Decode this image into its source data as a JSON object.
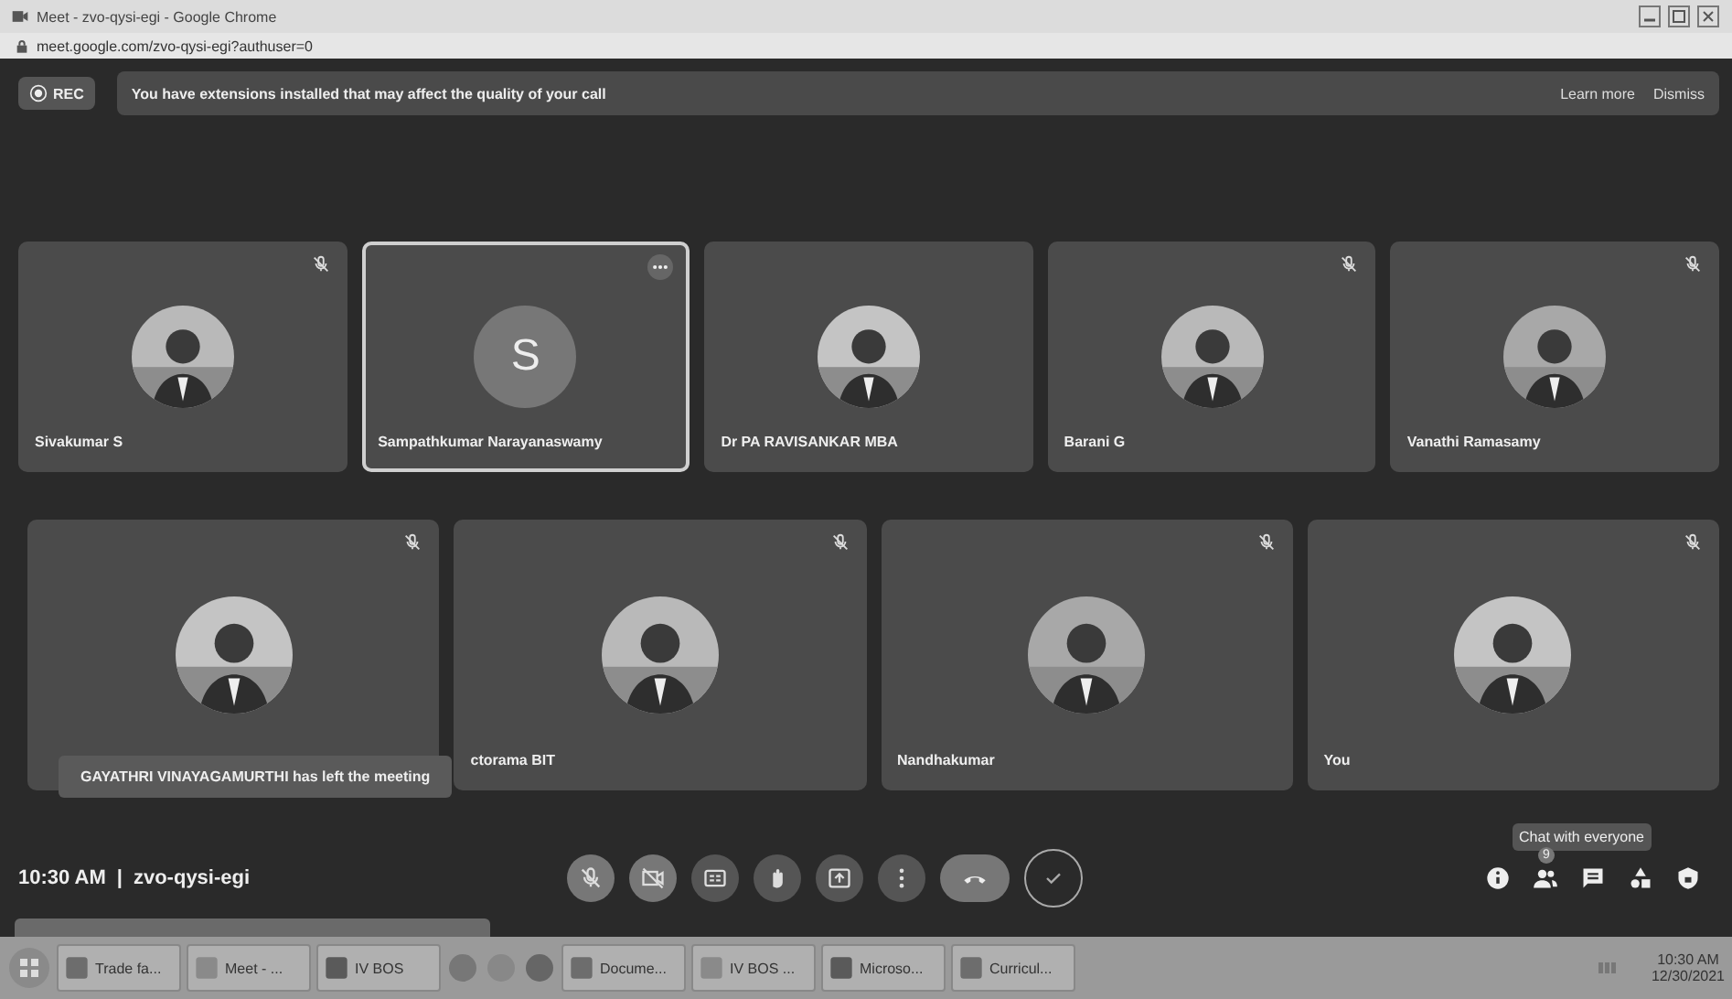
{
  "window": {
    "title": "Meet - zvo-qysi-egi - Google Chrome",
    "url": "meet.google.com/zvo-qysi-egi?authuser=0"
  },
  "banner": {
    "rec": "REC",
    "message": "You have extensions installed that may affect the quality of your call",
    "actions": [
      "Learn more",
      "Dismiss"
    ]
  },
  "tiles": [
    {
      "name": "Sivakumar S",
      "muted": true,
      "selected": false,
      "kind": "picture"
    },
    {
      "name": "Sampathkumar Narayanaswamy",
      "muted": false,
      "selected": true,
      "kind": "initial",
      "letter": "S"
    },
    {
      "name": "Dr PA RAVISANKAR MBA",
      "muted": false,
      "selected": false,
      "kind": "picture"
    },
    {
      "name": "Barani G",
      "muted": true,
      "selected": false,
      "kind": "picture"
    },
    {
      "name": "Vanathi Ramasamy",
      "muted": true,
      "selected": false,
      "kind": "picture"
    },
    {
      "muted": true,
      "selected": false,
      "kind": "picture"
    },
    {
      "name": "ctorama BIT",
      "muted": true,
      "selected": false,
      "kind": "picture"
    },
    {
      "name": "Nandhakumar",
      "muted": true,
      "selected": false,
      "kind": "picture"
    },
    {
      "name": "You",
      "muted": true,
      "selected": false,
      "kind": "picture"
    }
  ],
  "notification": "GAYATHRI VINAYAGAMURTHI has left the meeting",
  "meeting_info": {
    "time": "10:30 AM",
    "separator": "|",
    "code": "zvo-qysi-egi"
  },
  "tooltip": "Chat with everyone",
  "people_badge": "9",
  "taskbar": {
    "items": [
      "Trade fa...",
      "Meet - ...",
      "IV BOS",
      "Docume...",
      "IV BOS ...",
      "Microso...",
      "Curricul..."
    ],
    "time": "10:30 AM",
    "date": "12/30/2021"
  }
}
